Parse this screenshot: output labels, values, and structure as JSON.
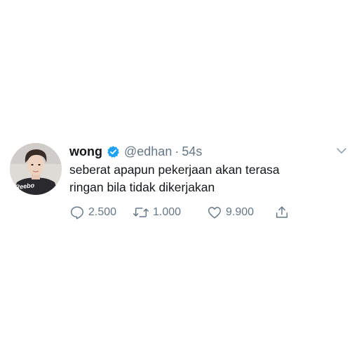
{
  "tweet": {
    "display_name": "wong",
    "handle": "@edhan",
    "separator": "·",
    "time": "54s",
    "text_lines": [
      "seberat apapun pekerjaan akan terasa",
      "ringan bila tidak dikerjakan"
    ],
    "avatar_shirt_text": "Reebo",
    "actions": {
      "reply_count": "2.500",
      "retweet_count": "1.000",
      "like_count": "9.900"
    },
    "icons": {
      "verified": "verified-badge-icon",
      "menu": "chevron-down-icon",
      "reply": "speech-bubble-icon",
      "retweet": "retweet-arrows-icon",
      "like": "heart-icon",
      "share": "share-upload-icon"
    },
    "colors": {
      "verified_badge": "#1da1f2",
      "text_primary": "#14171a",
      "text_secondary": "#657786"
    }
  }
}
